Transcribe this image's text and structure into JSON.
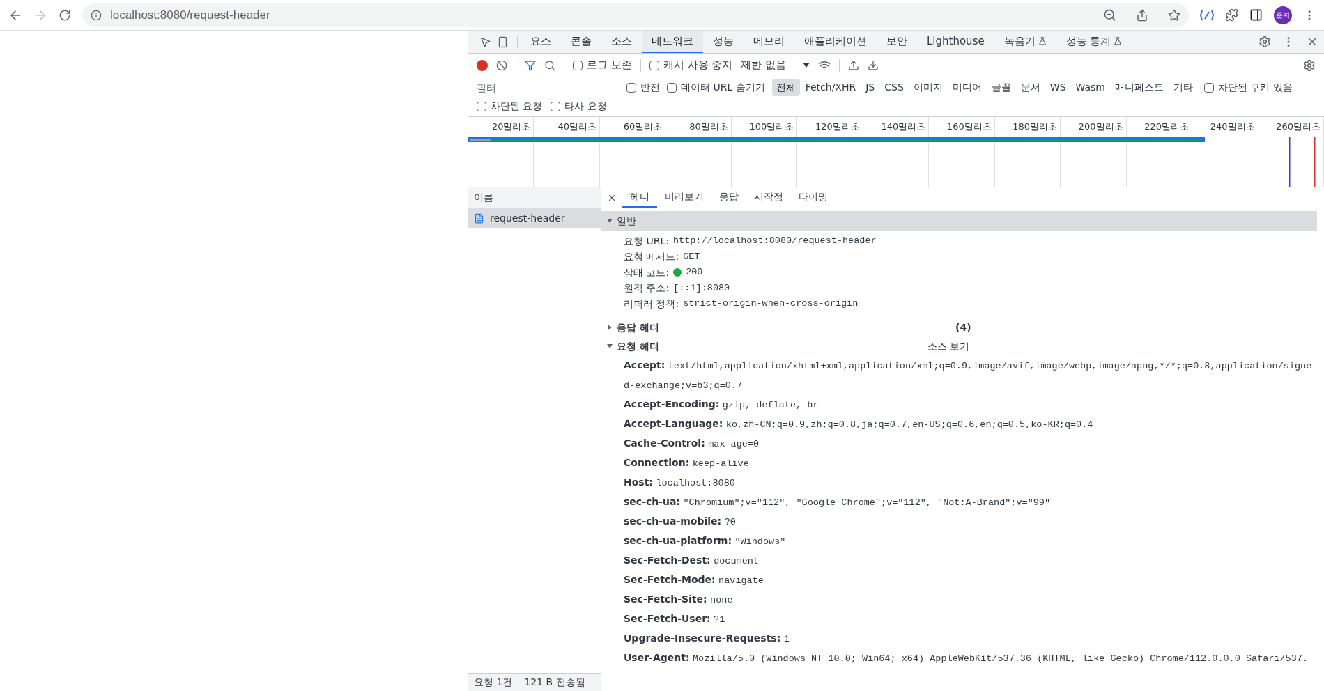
{
  "browser": {
    "url": "localhost:8080/request-header",
    "profile": "준희"
  },
  "devtools": {
    "tabs": [
      {
        "label": "요소",
        "selected": false
      },
      {
        "label": "콘솔",
        "selected": false
      },
      {
        "label": "소스",
        "selected": false
      },
      {
        "label": "네트워크",
        "selected": true
      },
      {
        "label": "성능",
        "selected": false
      },
      {
        "label": "메모리",
        "selected": false
      },
      {
        "label": "애플리케이션",
        "selected": false
      },
      {
        "label": "보안",
        "selected": false
      },
      {
        "label": "Lighthouse",
        "selected": false
      },
      {
        "label": "녹음기",
        "selected": false,
        "experimental": true
      },
      {
        "label": "성능 통계",
        "selected": false,
        "experimental": true
      }
    ],
    "toolbar": {
      "recording": true,
      "preserve_log": {
        "label": "로그 보존",
        "checked": false
      },
      "disable_cache": {
        "label": "캐시 사용 중지",
        "checked": false
      },
      "throttling": "제한 없음"
    },
    "filter": {
      "placeholder": "필터",
      "invert": {
        "label": "반전",
        "checked": false
      },
      "hide_data_urls": {
        "label": "데이터 URL 숨기기",
        "checked": false
      },
      "types": [
        {
          "label": "전체",
          "selected": true
        },
        {
          "label": "Fetch/XHR",
          "selected": false
        },
        {
          "label": "JS",
          "selected": false
        },
        {
          "label": "CSS",
          "selected": false
        },
        {
          "label": "이미지",
          "selected": false
        },
        {
          "label": "미디어",
          "selected": false
        },
        {
          "label": "글꼴",
          "selected": false
        },
        {
          "label": "문서",
          "selected": false
        },
        {
          "label": "WS",
          "selected": false
        },
        {
          "label": "Wasm",
          "selected": false
        },
        {
          "label": "매니페스트",
          "selected": false
        },
        {
          "label": "기타",
          "selected": false
        }
      ],
      "blocked_cookies": {
        "label": "차단된 쿠키 있음",
        "checked": false
      },
      "blocked_requests": {
        "label": "차단된 요청",
        "checked": false
      },
      "third_party": {
        "label": "타사 요청",
        "checked": false
      }
    },
    "timeline": {
      "ticks": [
        "20밀리초",
        "40밀리초",
        "60밀리초",
        "80밀리초",
        "100밀리초",
        "120밀리초",
        "140밀리초",
        "160밀리초",
        "180밀리초",
        "200밀리초",
        "220밀리초",
        "240밀리초",
        "260밀리초"
      ]
    },
    "requests": {
      "column": "이름",
      "rows": [
        {
          "name": "request-header",
          "selected": true
        }
      ]
    },
    "status_bar": [
      "요청 1건",
      "121 B 전송됨"
    ],
    "detail_tabs": [
      {
        "label": "헤더",
        "selected": true
      },
      {
        "label": "미리보기",
        "selected": false
      },
      {
        "label": "응답",
        "selected": false
      },
      {
        "label": "시작점",
        "selected": false
      },
      {
        "label": "타이밍",
        "selected": false
      }
    ],
    "general": {
      "title": "일반",
      "expanded": true,
      "rows": [
        {
          "label": "요청 URL:",
          "value": "http://localhost:8080/request-header"
        },
        {
          "label": "요청 메서드:",
          "value": "GET"
        },
        {
          "label": "상태 코드:",
          "value": "200",
          "color": "#1ea446"
        },
        {
          "label": "원격 주소:",
          "value": "[::1]:8080"
        },
        {
          "label": "리퍼러 정책:",
          "value": "strict-origin-when-cross-origin"
        }
      ]
    },
    "response_headers": {
      "title": "응답 헤더",
      "expanded": false,
      "count": "(4)"
    },
    "request_headers": {
      "title": "요청 헤더",
      "expanded": true,
      "link": "소스 보기",
      "rows": [
        {
          "name": "Accept:",
          "value": "text/html,application/xhtml+xml,application/xml;q=0.9,image/avif,image/webp,image/apng,*/*;q=0.8,application/signed-exchange;v=b3;q=0.7"
        },
        {
          "name": "Accept-Encoding:",
          "value": "gzip, deflate, br"
        },
        {
          "name": "Accept-Language:",
          "value": "ko,zh-CN;q=0.9,zh;q=0.8,ja;q=0.7,en-US;q=0.6,en;q=0.5,ko-KR;q=0.4"
        },
        {
          "name": "Cache-Control:",
          "value": "max-age=0"
        },
        {
          "name": "Connection:",
          "value": "keep-alive"
        },
        {
          "name": "Host:",
          "value": "localhost:8080"
        },
        {
          "name": "sec-ch-ua:",
          "value": "\"Chromium\";v=\"112\", \"Google Chrome\";v=\"112\", \"Not:A-Brand\";v=\"99\""
        },
        {
          "name": "sec-ch-ua-mobile:",
          "value": "?0"
        },
        {
          "name": "sec-ch-ua-platform:",
          "value": "\"Windows\""
        },
        {
          "name": "Sec-Fetch-Dest:",
          "value": "document"
        },
        {
          "name": "Sec-Fetch-Mode:",
          "value": "navigate"
        },
        {
          "name": "Sec-Fetch-Site:",
          "value": "none"
        },
        {
          "name": "Sec-Fetch-User:",
          "value": "?1"
        },
        {
          "name": "Upgrade-Insecure-Requests:",
          "value": "1"
        },
        {
          "name": "User-Agent:",
          "value": "Mozilla/5.0 (Windows NT 10.0; Win64; x64) AppleWebKit/537.36 (KHTML, like Gecko) Chrome/112.0.0.0 Safari/537."
        }
      ]
    }
  }
}
